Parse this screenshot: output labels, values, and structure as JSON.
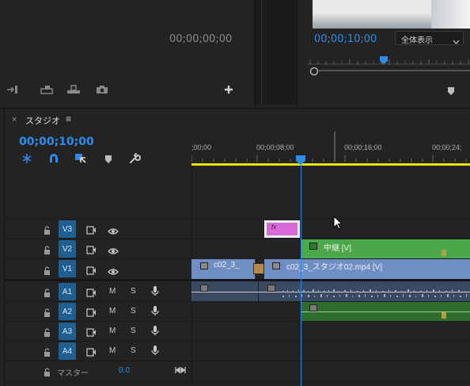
{
  "source_monitor": {
    "timecode": "00;00;00;00"
  },
  "program_monitor": {
    "timecode": "00;00;10;00",
    "zoom_select": "全体表示"
  },
  "timeline": {
    "close_symbol": "×",
    "tab_title": "スタジオ",
    "menu_symbol": "≡",
    "playhead_timecode": "00;00;10;00",
    "ruler_labels": [
      ";00;00",
      "00;00;08;00",
      "00;00;16;00",
      "00;00;24;"
    ],
    "tracks": {
      "video": [
        {
          "name": "V3"
        },
        {
          "name": "V2"
        },
        {
          "name": "V1"
        }
      ],
      "audio": [
        {
          "name": "A1",
          "mute": "M",
          "solo": "S"
        },
        {
          "name": "A2",
          "mute": "M",
          "solo": "S"
        },
        {
          "name": "A3",
          "mute": "M",
          "solo": "S"
        },
        {
          "name": "A4",
          "mute": "M",
          "solo": "S"
        }
      ]
    },
    "master": {
      "label": "マスター",
      "value": "0.0"
    },
    "clips": {
      "v3_fx": "fx",
      "v2_title": "中継 [V]",
      "v1_clip_a": "c02_3_",
      "v1_clip_b": "c02_3_スタジオ02.mp4 [V]"
    }
  },
  "colors": {
    "accent_blue": "#2d8ceb",
    "track_button_blue": "#1f5f91",
    "v2_clip_green": "#4aa84a",
    "v1_clip_blue": "#6f8fc4",
    "v3_clip_pink": "#d86ad8",
    "a2_clip_green": "#2e6d2e",
    "work_area_yellow": "#e5e500"
  }
}
